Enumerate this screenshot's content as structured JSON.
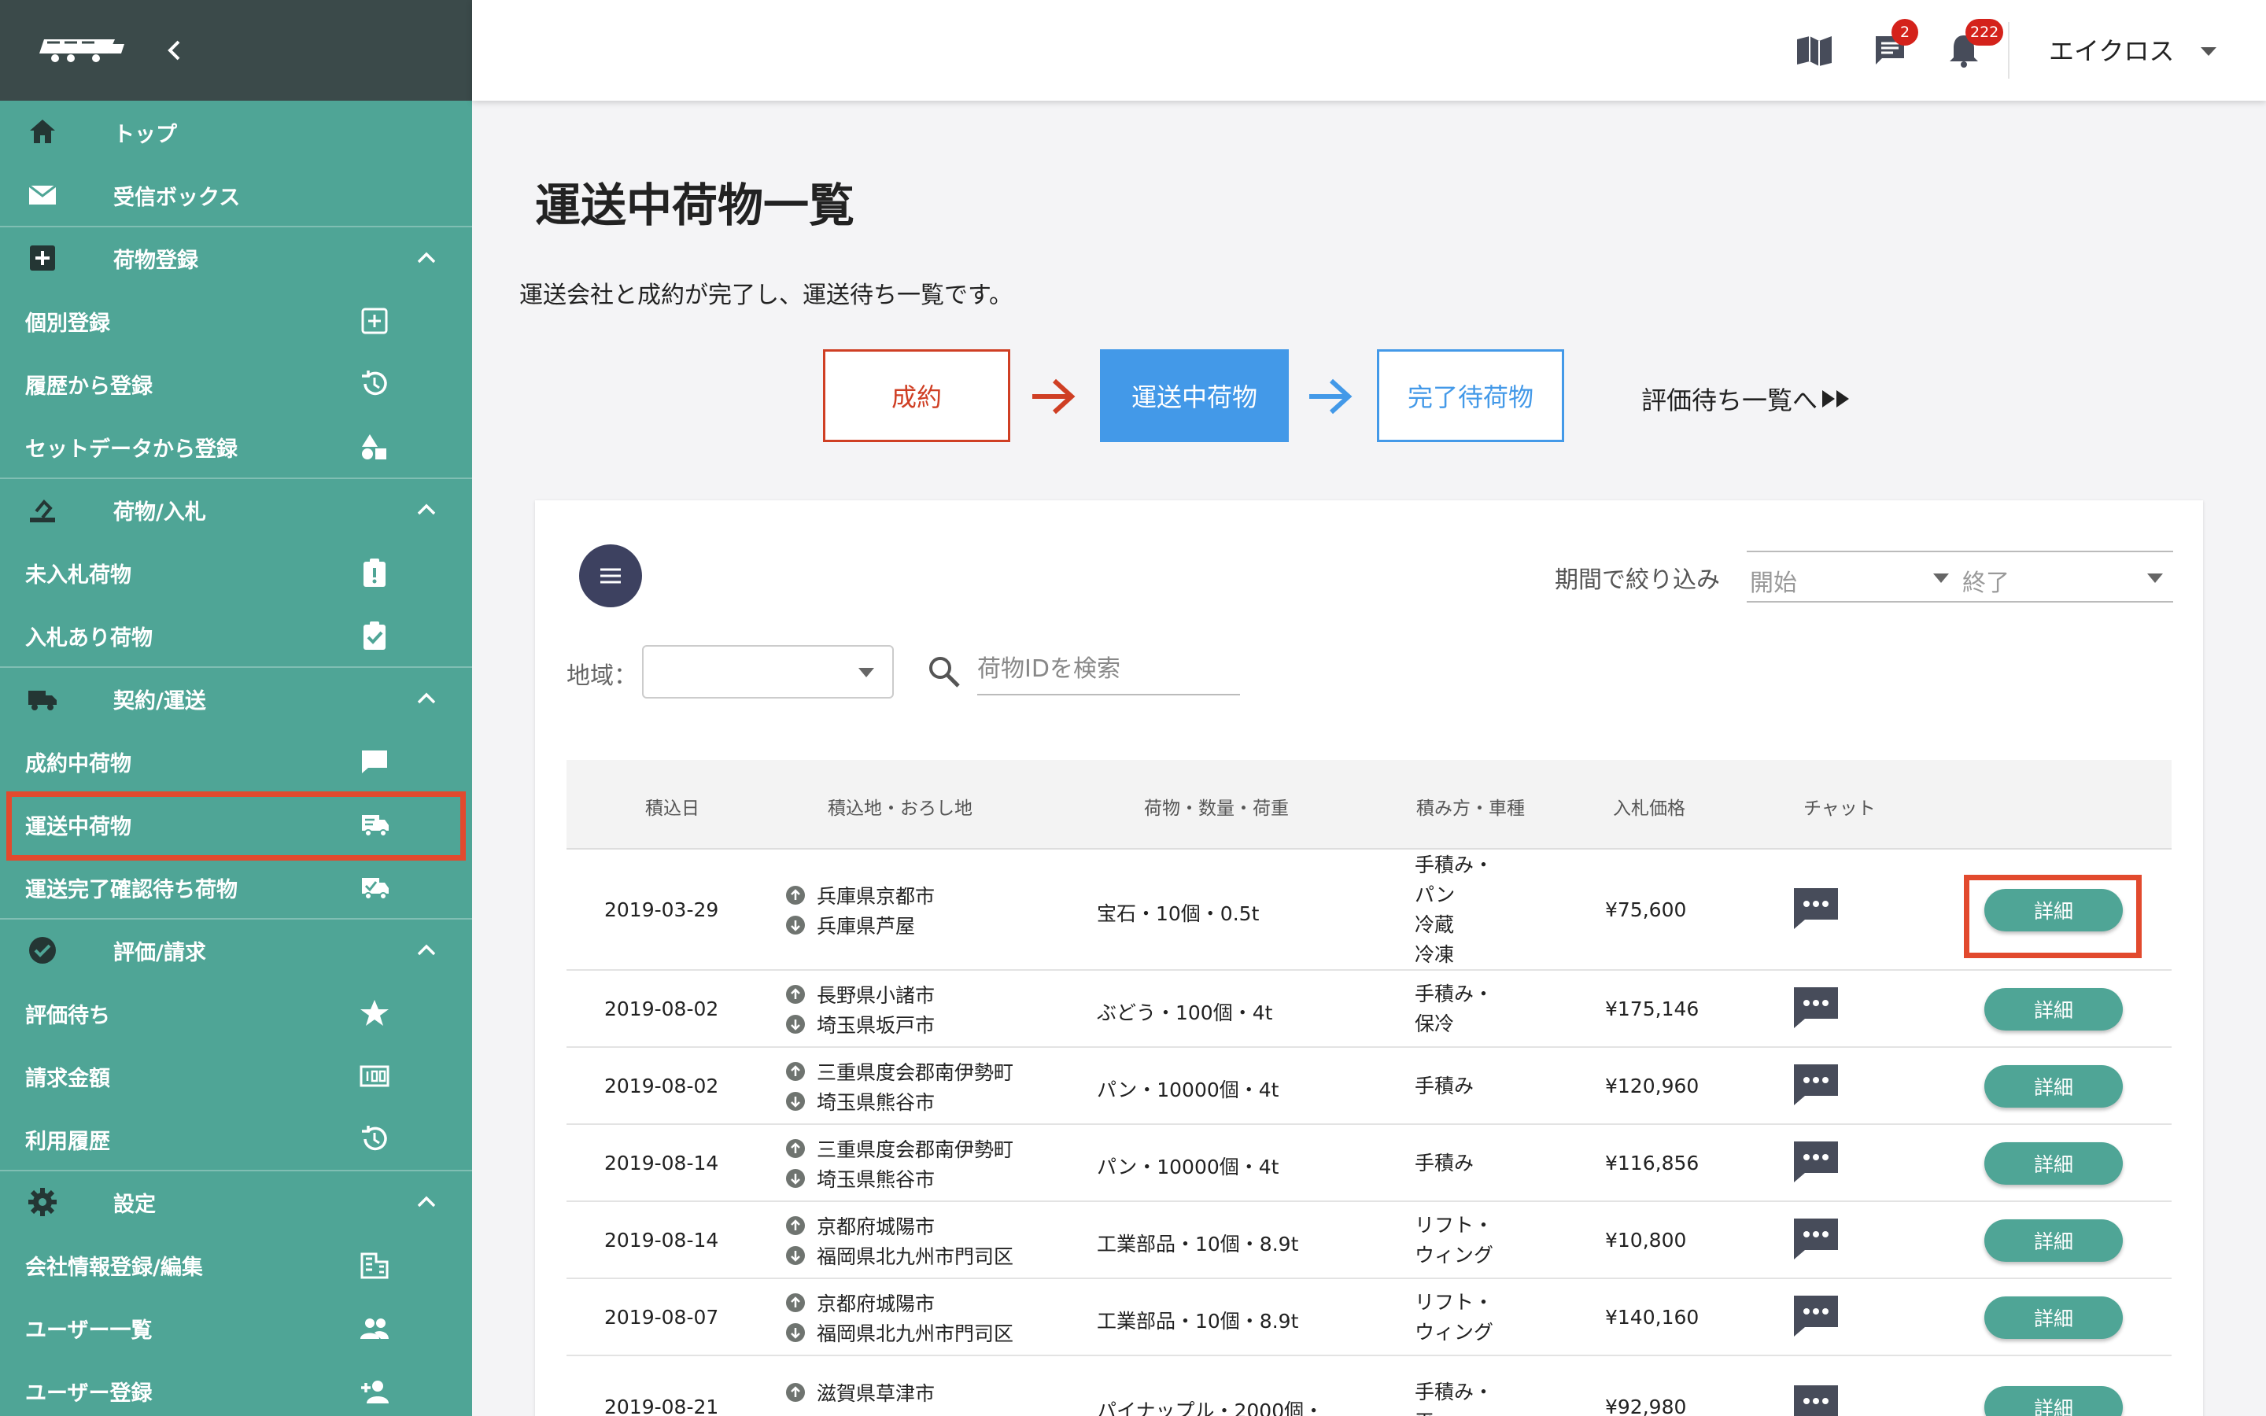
{
  "header": {
    "chat_badge": "2",
    "notification_badge": "222",
    "user_name": "エイクロス"
  },
  "sidebar": {
    "items": [
      {
        "type": "item-top",
        "label": "トップ",
        "icon": "home-icon"
      },
      {
        "type": "item-top",
        "label": "受信ボックス",
        "icon": "mail-icon"
      },
      {
        "type": "section",
        "label": "荷物登録",
        "icon": "add-box-icon"
      },
      {
        "type": "item",
        "label": "個別登録",
        "icon": "add-square-icon"
      },
      {
        "type": "item",
        "label": "履歴から登録",
        "icon": "history-icon"
      },
      {
        "type": "item",
        "label": "セットデータから登録",
        "icon": "shapes-icon"
      },
      {
        "type": "section",
        "label": "荷物/入札",
        "icon": "bid-icon"
      },
      {
        "type": "item",
        "label": "未入札荷物",
        "icon": "clipboard-alert-icon"
      },
      {
        "type": "item",
        "label": "入札あり荷物",
        "icon": "clipboard-check-icon"
      },
      {
        "type": "section",
        "label": "契約/運送",
        "icon": "truck-icon"
      },
      {
        "type": "item",
        "label": "成約中荷物",
        "icon": "message-icon"
      },
      {
        "type": "item",
        "label": "運送中荷物",
        "icon": "truck-fast-icon",
        "active": true
      },
      {
        "type": "item",
        "label": "運送完了確認待ち荷物",
        "icon": "truck-check-icon"
      },
      {
        "type": "section",
        "label": "評価/請求",
        "icon": "check-circle-icon"
      },
      {
        "type": "item",
        "label": "評価待ち",
        "icon": "star-icon"
      },
      {
        "type": "item",
        "label": "請求金額",
        "icon": "counter-icon"
      },
      {
        "type": "item",
        "label": "利用履歴",
        "icon": "history-icon"
      },
      {
        "type": "section",
        "label": "設定",
        "icon": "gear-icon"
      },
      {
        "type": "item",
        "label": "会社情報登録/編集",
        "icon": "building-icon"
      },
      {
        "type": "item",
        "label": "ユーザー一覧",
        "icon": "users-icon"
      },
      {
        "type": "item",
        "label": "ユーザー登録",
        "icon": "user-add-icon"
      }
    ]
  },
  "main": {
    "title": "運送中荷物一覧",
    "description": "運送会社と成約が完了し、運送待ち一覧です。",
    "steps": {
      "step1": "成約",
      "step2": "運送中荷物",
      "step3": "完了待荷物",
      "next_link": "評価待ち一覧へ"
    },
    "filters": {
      "period_label": "期間で絞り込み",
      "start_placeholder": "開始",
      "end_placeholder": "終了",
      "region_label": "地域：",
      "search_placeholder": "荷物IDを検索"
    },
    "table": {
      "headers": [
        "積込日",
        "積込地・おろし地",
        "荷物・数量・荷重",
        "積み方・車種",
        "入札価格",
        "チャット"
      ],
      "detail_label": "詳細",
      "rows": [
        {
          "date": "2019-03-29",
          "from": "兵庫県京都市",
          "to": "兵庫県芦屋",
          "cargo": "宝石・10個・0.5t",
          "method": [
            "手積み・",
            "パン",
            "冷蔵",
            "冷凍"
          ],
          "price": "¥75,600"
        },
        {
          "date": "2019-08-02",
          "from": "長野県小諸市",
          "to": "埼玉県坂戸市",
          "cargo": "ぶどう・100個・4t",
          "method": [
            "手積み・",
            "保冷"
          ],
          "price": "¥175,146"
        },
        {
          "date": "2019-08-02",
          "from": "三重県度会郡南伊勢町",
          "to": "埼玉県熊谷市",
          "cargo": "パン・10000個・4t",
          "method": [
            "手積み"
          ],
          "price": "¥120,960"
        },
        {
          "date": "2019-08-14",
          "from": "三重県度会郡南伊勢町",
          "to": "埼玉県熊谷市",
          "cargo": "パン・10000個・4t",
          "method": [
            "手積み"
          ],
          "price": "¥116,856"
        },
        {
          "date": "2019-08-14",
          "from": "京都府城陽市",
          "to": "福岡県北九州市門司区",
          "cargo": "工業部品・10個・8.9t",
          "method": [
            "リフト・",
            "ウィング"
          ],
          "price": "¥10,800"
        },
        {
          "date": "2019-08-07",
          "from": "京都府城陽市",
          "to": "福岡県北九州市門司区",
          "cargo": "工業部品・10個・8.9t",
          "method": [
            "リフト・",
            "ウィング"
          ],
          "price": "¥140,160"
        },
        {
          "date": "2019-08-21",
          "from": "滋賀県草津市",
          "to": "",
          "cargo": "パイナップル・2000個・",
          "method": [
            "手積み・",
            "平"
          ],
          "price": "¥92,980"
        }
      ]
    }
  }
}
